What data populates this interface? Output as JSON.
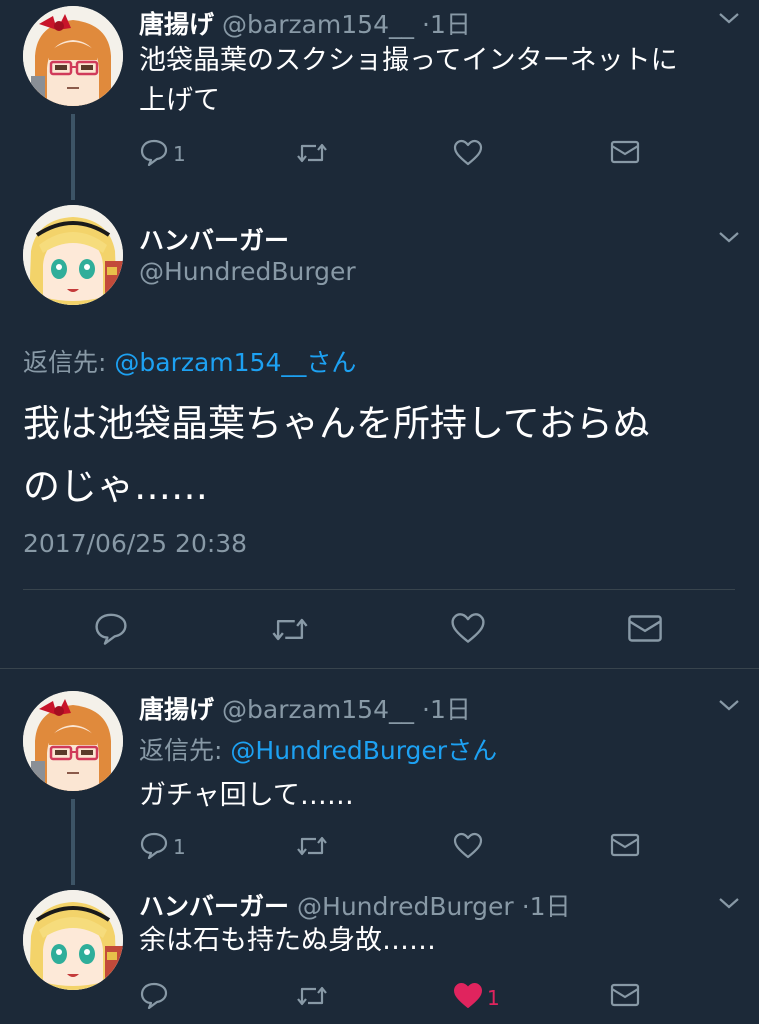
{
  "tweet1": {
    "name": "唐揚げ",
    "handle": "@barzam154__",
    "time": "·1日",
    "text_line1": "池袋晶葉のスクショ撮ってインターネットに",
    "text_line2": "上げて",
    "reply_count": "1"
  },
  "main_tweet": {
    "name": "ハンバーガー",
    "handle": "@HundredBurger",
    "reply_prefix": "返信先:",
    "reply_target": "@barzam154__",
    "reply_suffix": "さん",
    "text_line1": "我は池袋晶葉ちゃんを所持しておらぬ",
    "text_line2": "のじゃ……",
    "timestamp": "2017/06/25 20:38"
  },
  "tweet3": {
    "name": "唐揚げ",
    "handle": "@barzam154__",
    "time": "·1日",
    "reply_prefix": "返信先:",
    "reply_target": "@HundredBurger",
    "reply_suffix": "さん",
    "text": "ガチャ回して……",
    "reply_count": "1"
  },
  "tweet4": {
    "name": "ハンバーガー",
    "handle": "@HundredBurger",
    "time": "·1日",
    "text": "余は石も持たぬ身故……",
    "like_count": "1"
  },
  "colors": {
    "background": "#1c2938",
    "secondary_text": "#8899a6",
    "link": "#1da1f2",
    "like_active": "#e0245e",
    "divider": "#38444d"
  },
  "icons": [
    "reply-icon",
    "retweet-icon",
    "like-icon",
    "dm-icon",
    "chevron-down-icon"
  ]
}
